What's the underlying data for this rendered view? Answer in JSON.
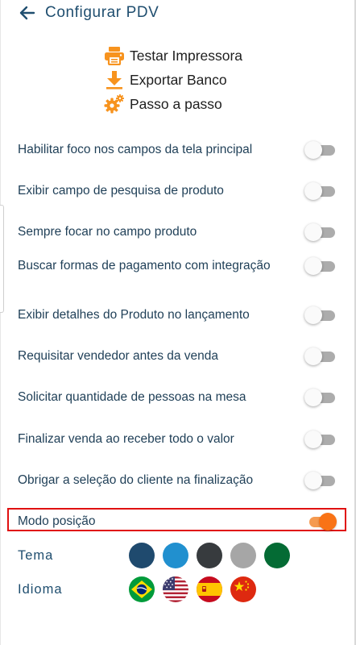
{
  "header": {
    "title": "Configurar PDV"
  },
  "actions": [
    {
      "label": "Testar Impressora",
      "icon": "printer-icon"
    },
    {
      "label": "Exportar Banco",
      "icon": "download-icon"
    },
    {
      "label": "Passo a passo",
      "icon": "gears-icon"
    }
  ],
  "settings": [
    {
      "label": "Habilitar foco nos campos da tela principal",
      "enabled": false
    },
    {
      "label": "Exibir campo de pesquisa de produto",
      "enabled": false
    },
    {
      "label": "Sempre focar no campo produto",
      "enabled": false
    },
    {
      "label": "Buscar formas de pagamento com integração",
      "enabled": false
    },
    {
      "label": "Exibir detalhes do Produto no lançamento",
      "enabled": false
    },
    {
      "label": "Requisitar vendedor antes da venda",
      "enabled": false
    },
    {
      "label": "Solicitar quantidade de pessoas na mesa",
      "enabled": false
    },
    {
      "label": "Finalizar venda ao receber todo o valor",
      "enabled": false
    },
    {
      "label": "Obrigar a seleção do cliente na finalização",
      "enabled": false
    },
    {
      "label": "Modo posição",
      "enabled": true
    }
  ],
  "theme": {
    "label": "Tema",
    "colors": [
      "#1f4a6e",
      "#2190cf",
      "#373b3e",
      "#a6a6a6",
      "#046b34"
    ]
  },
  "language": {
    "label": "Idioma",
    "flags": [
      "brazil-flag-icon",
      "usa-flag-icon",
      "spain-flag-icon",
      "china-flag-icon"
    ]
  },
  "colors": {
    "accent": "#f97316",
    "title": "#1f4e6f",
    "highlight": "#e01010"
  }
}
